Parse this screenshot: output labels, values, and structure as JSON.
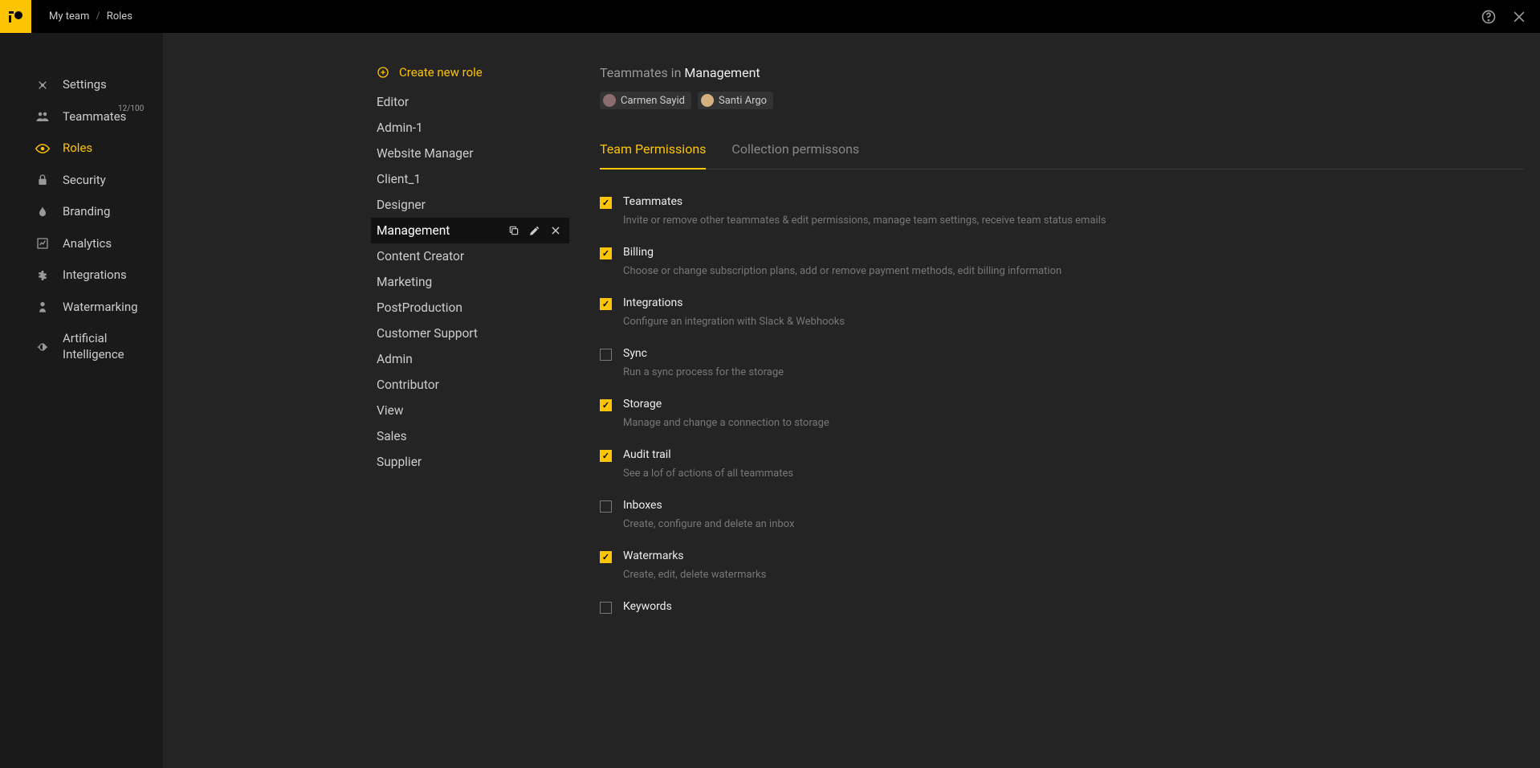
{
  "breadcrumb": {
    "parent": "My team",
    "current": "Roles"
  },
  "sidebar": {
    "items": [
      {
        "label": "Settings",
        "icon": "settings"
      },
      {
        "label": "Teammates",
        "icon": "teammates",
        "sup": "12/100"
      },
      {
        "label": "Roles",
        "icon": "roles",
        "active": true
      },
      {
        "label": "Security",
        "icon": "security"
      },
      {
        "label": "Branding",
        "icon": "branding"
      },
      {
        "label": "Analytics",
        "icon": "analytics"
      },
      {
        "label": "Integrations",
        "icon": "integrations"
      },
      {
        "label": "Watermarking",
        "icon": "watermarking"
      },
      {
        "label": "Artificial Intelligence",
        "icon": "ai"
      }
    ]
  },
  "create_role_label": "Create new role",
  "roles": [
    {
      "name": "Editor"
    },
    {
      "name": "Admin-1"
    },
    {
      "name": "Website Manager"
    },
    {
      "name": "Client_1"
    },
    {
      "name": "Designer"
    },
    {
      "name": "Management",
      "selected": true
    },
    {
      "name": "Content Creator"
    },
    {
      "name": "Marketing"
    },
    {
      "name": "PostProduction"
    },
    {
      "name": "Customer Support"
    },
    {
      "name": "Admin"
    },
    {
      "name": "Contributor"
    },
    {
      "name": "View"
    },
    {
      "name": "Sales"
    },
    {
      "name": "Supplier"
    }
  ],
  "teammates_header_prefix": "Teammates in ",
  "teammates_header_role": "Management",
  "teammates": [
    {
      "name": "Carmen Sayid",
      "avatar_bg": "#8a6d6d"
    },
    {
      "name": "Santi Argo",
      "avatar_bg": "#d4b080"
    }
  ],
  "tabs": [
    {
      "label": "Team Permissions",
      "active": true
    },
    {
      "label": "Collection permissons"
    }
  ],
  "permissions": [
    {
      "title": "Teammates",
      "desc": "Invite or remove other teammates & edit permissions, manage team settings, receive team status emails",
      "checked": true
    },
    {
      "title": "Billing",
      "desc": "Choose or change subscription plans, add or remove payment methods, edit billing information",
      "checked": true
    },
    {
      "title": "Integrations",
      "desc": "Configure an integration with Slack & Webhooks",
      "checked": true
    },
    {
      "title": "Sync",
      "desc": "Run a sync process for the storage",
      "checked": false
    },
    {
      "title": "Storage",
      "desc": "Manage and change a connection to storage",
      "checked": true
    },
    {
      "title": "Audit trail",
      "desc": "See a lof of actions of all teammates",
      "checked": true
    },
    {
      "title": "Inboxes",
      "desc": "Create, configure and delete an inbox",
      "checked": false
    },
    {
      "title": "Watermarks",
      "desc": "Create, edit, delete watermarks",
      "checked": true
    },
    {
      "title": "Keywords",
      "desc": "",
      "checked": false
    }
  ],
  "logo_text": "IO"
}
